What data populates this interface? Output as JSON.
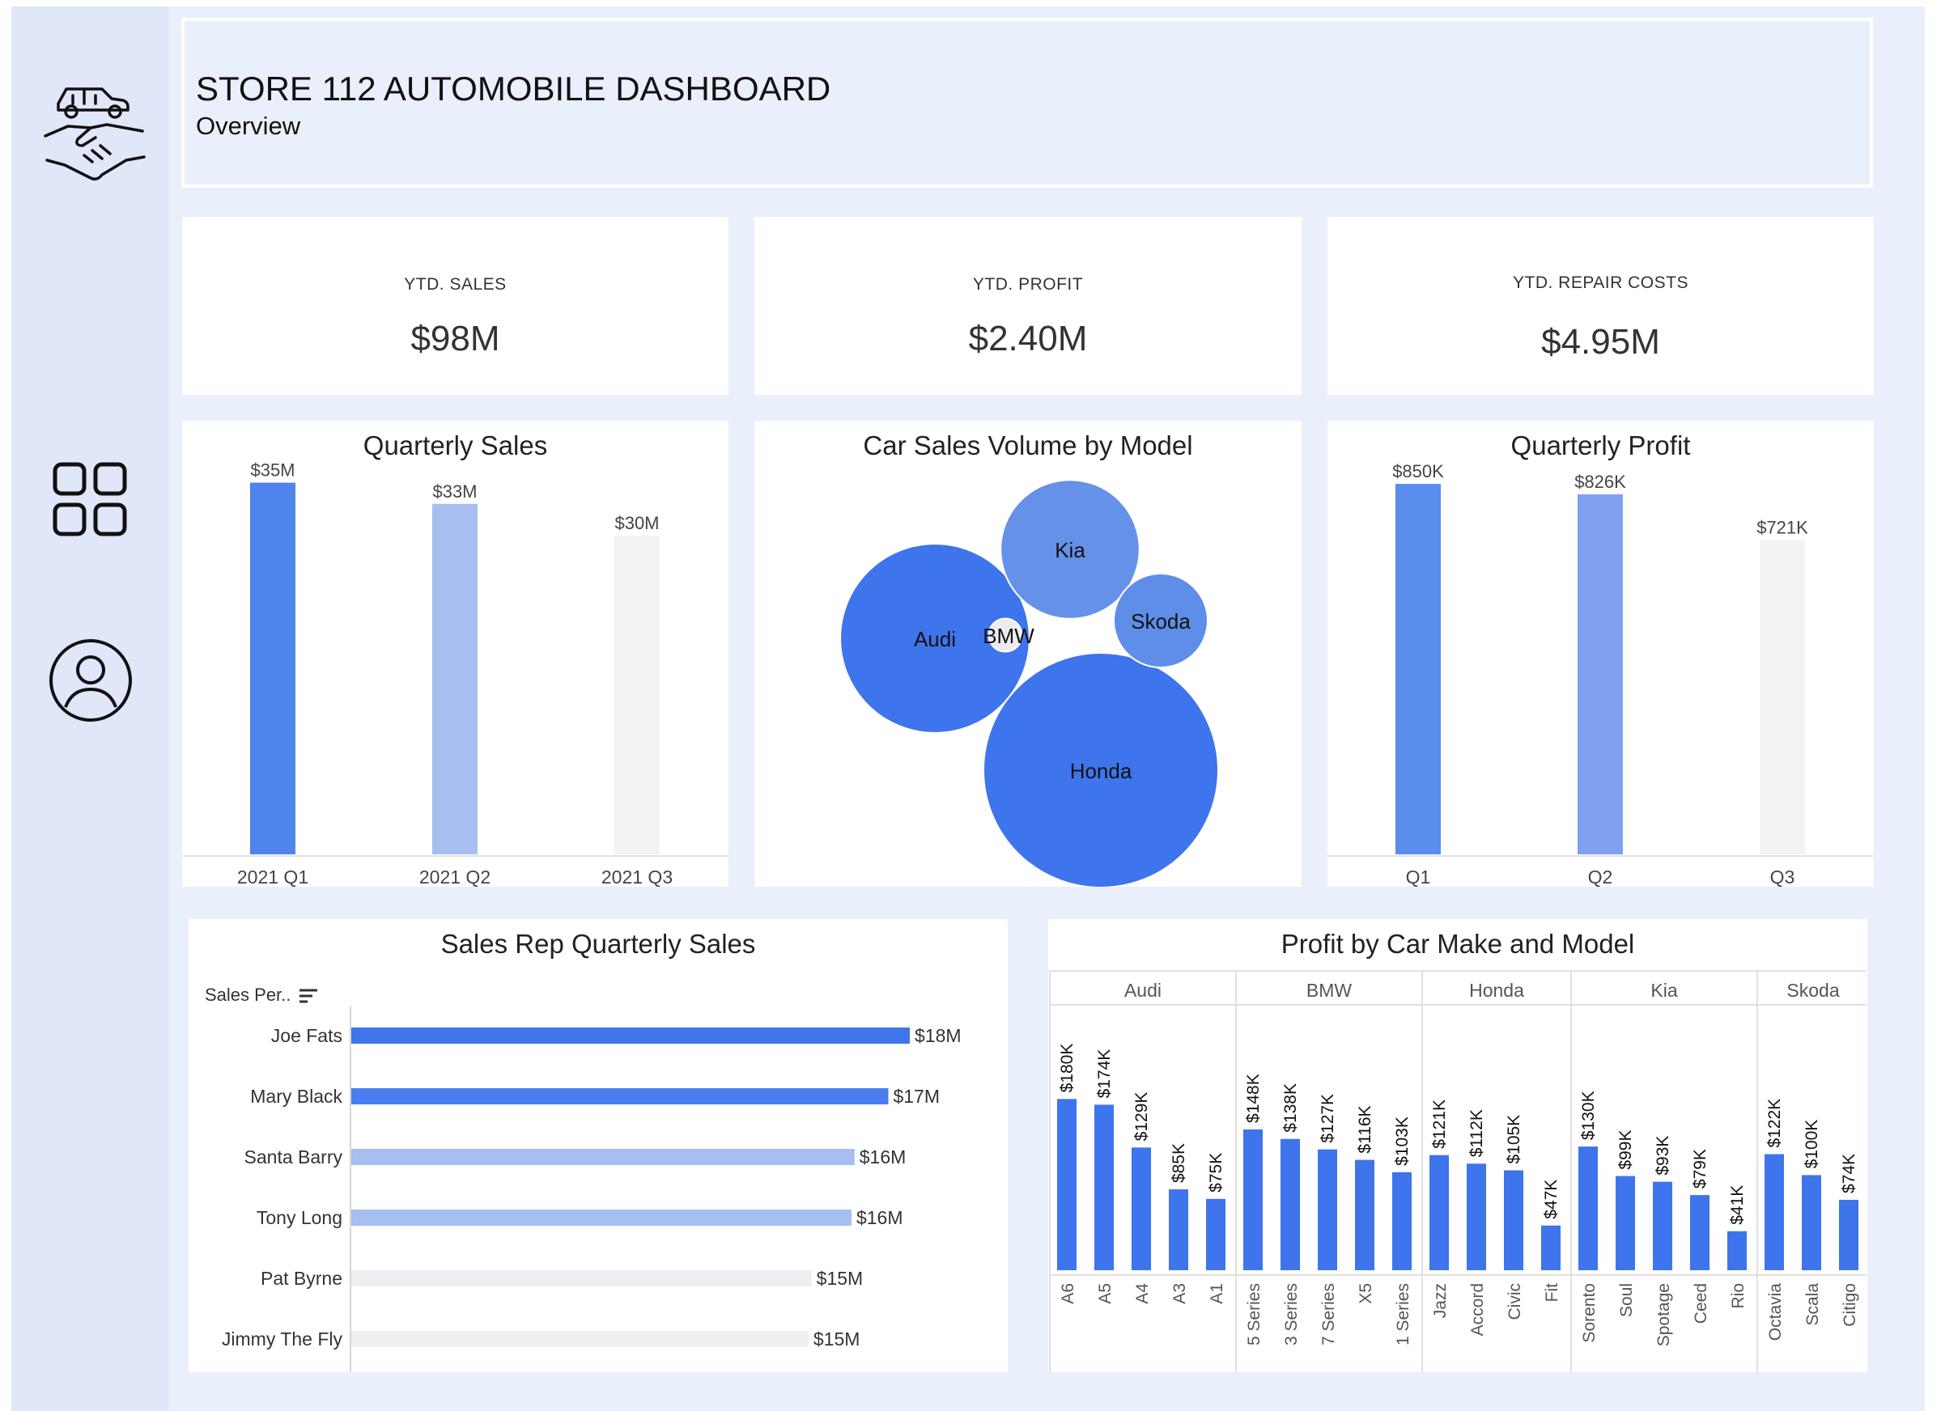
{
  "header": {
    "title": "STORE 112 AUTOMOBILE DASHBOARD",
    "subtitle": "Overview"
  },
  "sidebar": {
    "icons": [
      "car-handshake-icon",
      "grid-icon",
      "user-icon"
    ]
  },
  "kpis": [
    {
      "label": "YTD. SALES",
      "value": "$98M"
    },
    {
      "label": "YTD. PROFIT",
      "value": "$2.40M"
    },
    {
      "label": "YTD. REPAIR COSTS",
      "value": "$4.95M"
    }
  ],
  "colors": {
    "dark": "#4477ea",
    "mid": "#7fa1ed",
    "light": "#a6bef0",
    "faint": "#f1f2f4",
    "accent": "#3e74ec"
  },
  "chart_data": [
    {
      "type": "bar",
      "title": "Quarterly Sales",
      "categories": [
        "2021 Q1",
        "2021 Q2",
        "2021 Q3"
      ],
      "values": [
        35,
        33,
        30
      ],
      "labels": [
        "$35M",
        "$33M",
        "$30M"
      ],
      "colors": [
        "#4f84ec",
        "#a6bef0",
        "#f2f3f5"
      ],
      "unit": "$M"
    },
    {
      "type": "bubble",
      "title": "Car Sales Volume by Model",
      "categories": [
        "Honda",
        "Audi",
        "Kia",
        "Skoda",
        "BMW"
      ],
      "values": [
        100,
        65,
        35,
        16,
        2
      ]
    },
    {
      "type": "bar",
      "title": "Quarterly Profit",
      "categories": [
        "Q1",
        "Q2",
        "Q3"
      ],
      "values": [
        850,
        826,
        721
      ],
      "labels": [
        "$850K",
        "$826K",
        "$721K"
      ],
      "colors": [
        "#5b8def",
        "#7fa1ed",
        "#f2f3f5"
      ],
      "unit": "$K"
    },
    {
      "type": "bar",
      "orientation": "horizontal",
      "title": "Sales Rep Quarterly Sales",
      "column_header": "Sales Per..",
      "categories": [
        "Joe Fats",
        "Mary Black",
        "Santa Barry",
        "Tony Long",
        "Pat Byrne",
        "Jimmy The Fly"
      ],
      "values": [
        18.2,
        17.5,
        16.4,
        16.3,
        15.0,
        14.9
      ],
      "labels": [
        "$18M",
        "$17M",
        "$16M",
        "$16M",
        "$15M",
        "$15M"
      ],
      "colors": [
        "#3f76ec",
        "#4a7ded",
        "#a6bef0",
        "#a6bef0",
        "#eeeff2",
        "#eeeff2"
      ]
    },
    {
      "type": "bar",
      "title": "Profit by Car Make and Model",
      "groups": [
        {
          "name": "Audi",
          "models": [
            "A6",
            "A5",
            "A4",
            "A3",
            "A1"
          ],
          "values": [
            180,
            174,
            129,
            85,
            75
          ],
          "labels": [
            "$180K",
            "$174K",
            "$129K",
            "$85K",
            "$75K"
          ]
        },
        {
          "name": "BMW",
          "models": [
            "5 Series",
            "3 Series",
            "7 Series",
            "X5",
            "1 Series"
          ],
          "values": [
            148,
            138,
            127,
            116,
            103
          ],
          "labels": [
            "$148K",
            "$138K",
            "$127K",
            "$116K",
            "$103K"
          ]
        },
        {
          "name": "Honda",
          "models": [
            "Jazz",
            "Accord",
            "Civic",
            "Fit"
          ],
          "values": [
            121,
            112,
            105,
            47
          ],
          "labels": [
            "$121K",
            "$112K",
            "$105K",
            "$47K"
          ]
        },
        {
          "name": "Kia",
          "models": [
            "Sorento",
            "Soul",
            "Spotage",
            "Ceed",
            "Rio"
          ],
          "values": [
            130,
            99,
            93,
            79,
            41
          ],
          "labels": [
            "$130K",
            "$99K",
            "$93K",
            "$79K",
            "$41K"
          ]
        },
        {
          "name": "Skoda",
          "models": [
            "Octavia",
            "Scala",
            "Citigo"
          ],
          "values": [
            122,
            100,
            74
          ],
          "labels": [
            "$122K",
            "$100K",
            "$74K"
          ]
        }
      ]
    }
  ]
}
